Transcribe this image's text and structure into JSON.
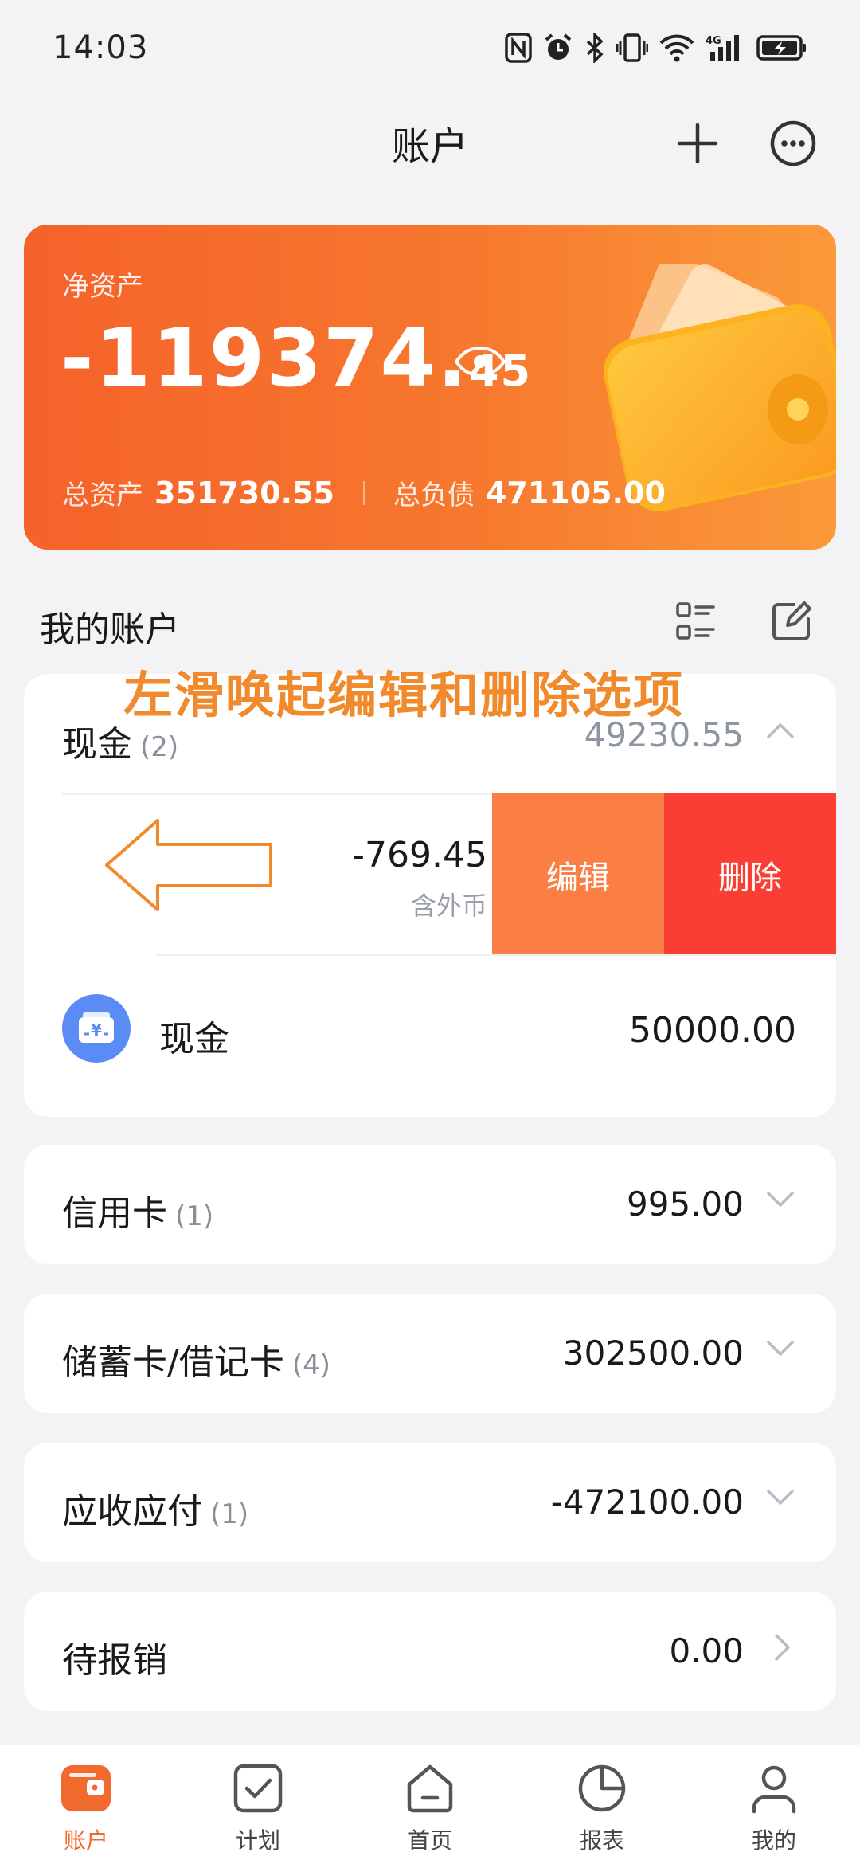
{
  "status_bar": {
    "time": "14:03",
    "network": "4G"
  },
  "header": {
    "title": "账户",
    "add_icon": "plus-icon",
    "more_icon": "more-icon"
  },
  "net_asset_card": {
    "label": "净资产",
    "value_int": "-119374.",
    "value_dec": "45",
    "total_assets_label": "总资产",
    "total_assets_value": "351730.55",
    "total_liabilities_label": "总负债",
    "total_liabilities_value": "471105.00",
    "gradient": [
      "#f5622a",
      "#fb9a3a"
    ]
  },
  "my_accounts": {
    "title": "我的账户"
  },
  "annotation": "左滑唤起编辑和删除选项",
  "groups": [
    {
      "name": "现金",
      "count": "(2)",
      "amount": "49230.55",
      "expanded": true,
      "swipe_item": {
        "amount": "-769.45",
        "note": "含外币",
        "edit_label": "编辑",
        "delete_label": "删除"
      },
      "accounts": [
        {
          "name": "现金",
          "amount": "50000.00",
          "icon": "cash-wallet-icon"
        }
      ]
    },
    {
      "name": "信用卡",
      "count": "(1)",
      "amount": "995.00",
      "expanded": false
    },
    {
      "name": "储蓄卡/借记卡",
      "count": "(4)",
      "amount": "302500.00",
      "expanded": false
    },
    {
      "name": "应收应付",
      "count": "(1)",
      "amount": "-472100.00",
      "expanded": false
    },
    {
      "name": "待报销",
      "count": "",
      "amount": "0.00",
      "expanded": false
    }
  ],
  "tabs": [
    {
      "label": "账户",
      "icon": "wallet-icon",
      "active": true
    },
    {
      "label": "计划",
      "icon": "checkbox-icon",
      "active": false
    },
    {
      "label": "首页",
      "icon": "home-icon",
      "active": false
    },
    {
      "label": "报表",
      "icon": "pie-chart-icon",
      "active": false
    },
    {
      "label": "我的",
      "icon": "person-icon",
      "active": false
    }
  ],
  "colors": {
    "accent": "#f06a2e",
    "edit": "#fb7f45",
    "delete": "#fa3e33",
    "account_icon": "#5b8cf5"
  }
}
